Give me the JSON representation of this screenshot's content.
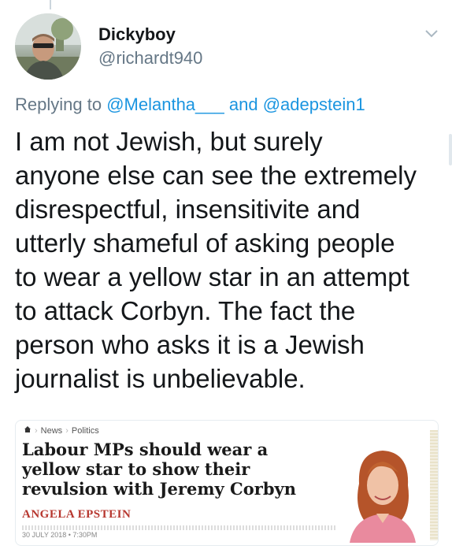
{
  "tweet": {
    "display_name": "Dickyboy",
    "handle": "@richardt940",
    "replying_prefix": "Replying to",
    "reply_to_1": "@Melantha___",
    "reply_joiner": "and",
    "reply_to_2": "@adepstein1",
    "text_lines": [
      "I am not Jewish, but surely",
      "anyone else can see the extremely",
      "disrespectful, insensitivite and",
      "utterly shameful of asking people",
      "to wear a yellow star in an attempt",
      "to attack Corbyn. The fact the",
      "person who asks it is a Jewish",
      "journalist is unbelievable."
    ]
  },
  "card": {
    "breadcrumb_1": "News",
    "breadcrumb_2": "Politics",
    "headline_lines": [
      "Labour MPs should wear a",
      "yellow star to show their",
      "revulsion with Jeremy Corbyn"
    ],
    "author": "ANGELA EPSTEIN",
    "date": "30 JULY 2018 • 7:30PM"
  },
  "icons": {
    "menu": "chevron-down-icon",
    "home": "home-icon"
  },
  "colors": {
    "link": "#1b95e0",
    "secondary_text": "#657786",
    "author_red": "#b7372f"
  }
}
